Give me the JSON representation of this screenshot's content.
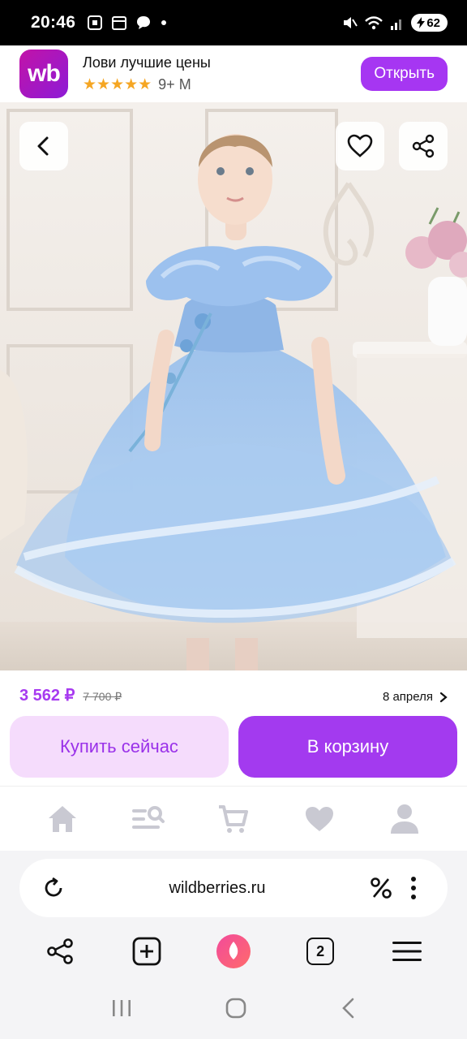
{
  "status_bar": {
    "time": "20:46",
    "battery": "62"
  },
  "app_banner": {
    "logo_text": "wb",
    "title": "Лови лучшие цены",
    "stars": "★★★★★",
    "downloads": "9+ M",
    "open_label": "Открыть"
  },
  "product": {
    "price": "3 562 ₽",
    "old_price": "7 700 ₽",
    "delivery": "8 апреля",
    "buy_now_label": "Купить сейчас",
    "cart_label": "В корзину"
  },
  "site_nav": {
    "items": [
      "home-icon",
      "catalog-search-icon",
      "cart-icon",
      "heart-icon",
      "profile-icon"
    ]
  },
  "browser": {
    "url": "wildberries.ru",
    "tabs_count": "2"
  },
  "colors": {
    "accent": "#a33aef",
    "accent_light": "#f5dcfc",
    "dress": "#9cc4ef"
  }
}
